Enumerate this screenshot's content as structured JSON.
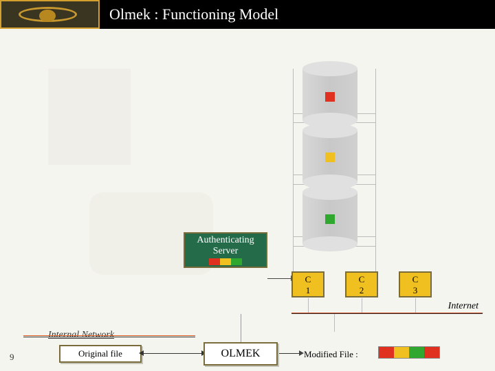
{
  "header": {
    "title": "Olmek : Functioning Model"
  },
  "auth_server": {
    "line1": "Authenticating",
    "line2": "Server"
  },
  "c_boxes": [
    {
      "line1": "C",
      "line2": "1"
    },
    {
      "line1": "C",
      "line2": "2"
    },
    {
      "line1": "C",
      "line2": "3"
    }
  ],
  "labels": {
    "internet": "Internet",
    "internal_network": "Internal Network",
    "original_file": "Original file",
    "olmek": "OLMEK",
    "modified_file": "Modified File  :"
  },
  "colors": {
    "red": "#e03020",
    "yellow": "#f0c020",
    "green": "#30a830",
    "auth_bg": "#246b4a",
    "border": "#7a6b3a",
    "separator_orange": "#d85820"
  },
  "slide_number": "9"
}
